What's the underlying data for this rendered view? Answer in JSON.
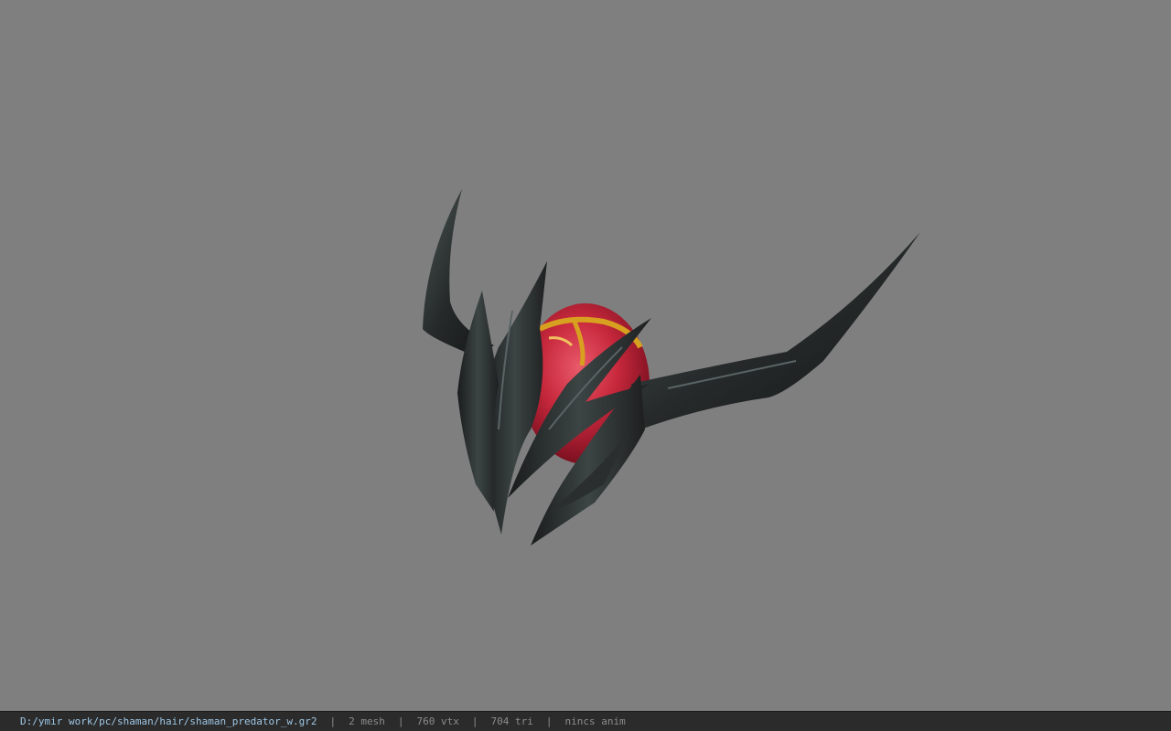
{
  "statusbar": {
    "file_path": "D:/ymir work/pc/shaman/hair/shaman_predator_w.gr2",
    "mesh_count": "2 mesh",
    "vertex_count": "760 vtx",
    "triangle_count": "704 tri",
    "animation": "nincs anim"
  },
  "viewport": {
    "background_color": "#7f7f7f",
    "model_colors": {
      "helmet": "#2a2e2e",
      "helmet_highlight": "#4a5252",
      "head": "#c8283c",
      "head_trim": "#d8a020"
    }
  }
}
